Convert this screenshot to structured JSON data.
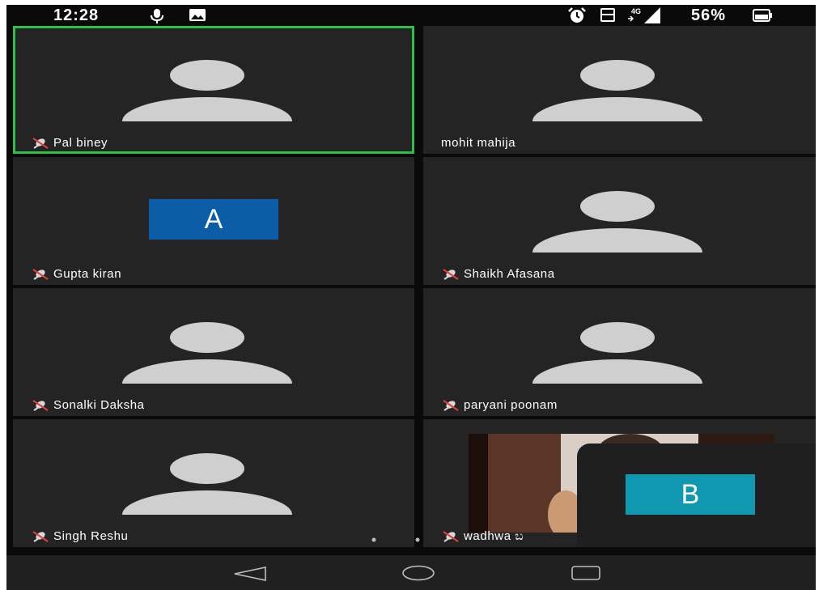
{
  "status_bar": {
    "time": "12:28",
    "battery_percent": "56%",
    "network": "4G"
  },
  "tiles": [
    {
      "name": "Pal biney",
      "muted": true,
      "active": true,
      "avatar": "silhouette"
    },
    {
      "name": "mohit mahija",
      "muted": false,
      "active": false,
      "avatar": "silhouette"
    },
    {
      "name": "Gupta kiran",
      "muted": true,
      "active": false,
      "avatar": "initial",
      "initial": "A",
      "initial_color": "#0b5da8"
    },
    {
      "name": "Shaikh Afasana",
      "muted": true,
      "active": false,
      "avatar": "silhouette"
    },
    {
      "name": "Sonalki Daksha",
      "muted": true,
      "active": false,
      "avatar": "silhouette"
    },
    {
      "name": "paryani poonam",
      "muted": true,
      "active": false,
      "avatar": "silhouette"
    },
    {
      "name": "Singh Reshu",
      "muted": true,
      "active": false,
      "avatar": "silhouette"
    },
    {
      "name": "wadhwa ಬ",
      "muted": true,
      "active": false,
      "avatar": "video"
    }
  ],
  "self_view": {
    "initial": "B",
    "initial_color": "#0f98b0"
  },
  "colors": {
    "active_border": "#2fbf4f",
    "tile_bg": "#242424",
    "mute_slash": "#e0413a"
  },
  "nav_bar": {
    "back": "back-icon",
    "home": "home-icon",
    "recents": "recents-icon"
  }
}
